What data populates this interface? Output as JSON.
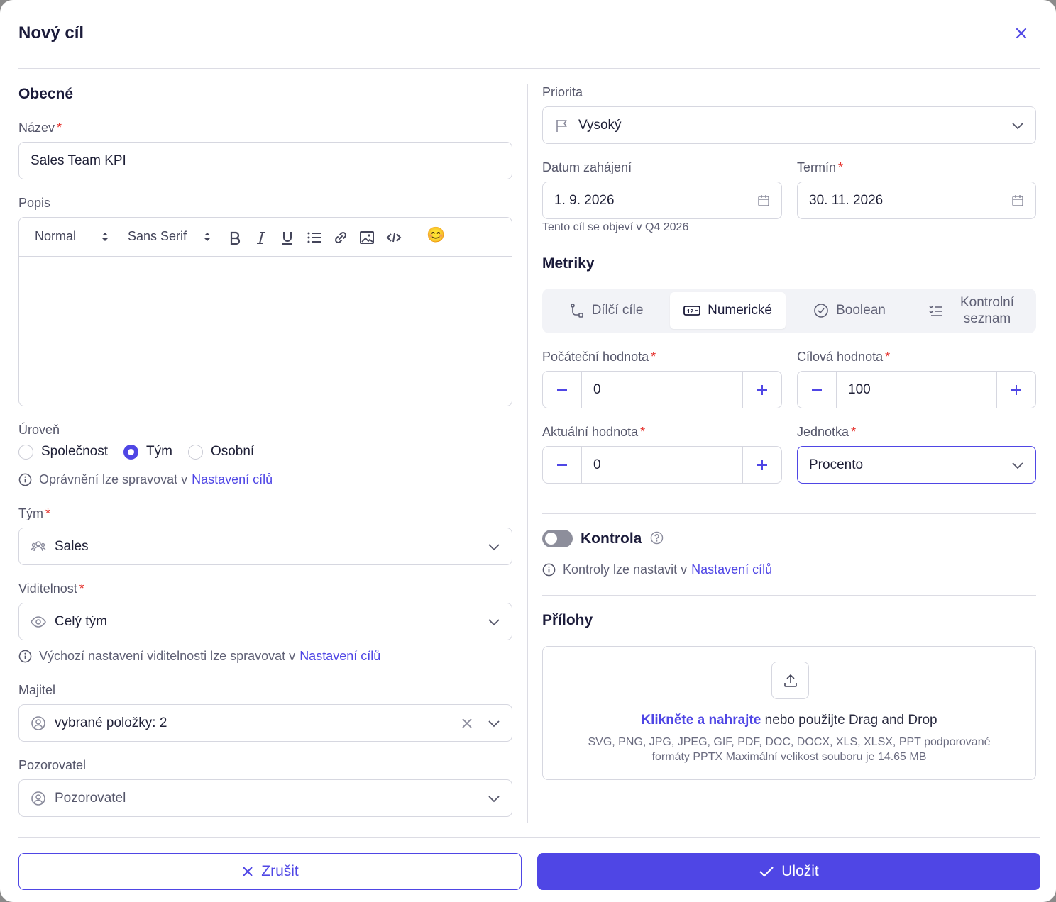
{
  "header": {
    "title": "Nový cíl"
  },
  "general": {
    "section_title": "Obecné",
    "name_label": "Název",
    "name_value": "Sales Team KPI",
    "description_label": "Popis",
    "editor": {
      "format": "Normal",
      "font": "Sans Serif",
      "emoji": "😊"
    },
    "level_label": "Úroveň",
    "level_options": [
      "Společnost",
      "Tým",
      "Osobní"
    ],
    "level_selected": "Tým",
    "permissions_text": "Oprávnění lze spravovat v",
    "settings_link": "Nastavení cílů",
    "team_label": "Tým",
    "team_value": "Sales",
    "visibility_label": "Viditelnost",
    "visibility_value": "Celý tým",
    "visibility_helper": "Výchozí nastavení viditelnosti lze spravovat v",
    "owner_label": "Majitel",
    "owner_value": "vybrané položky: 2",
    "observer_label": "Pozorovatel",
    "observer_placeholder": "Pozorovatel"
  },
  "right": {
    "priority_label": "Priorita",
    "priority_value": "Vysoký",
    "start_label": "Datum zahájení",
    "start_value": "1. 9. 2026",
    "due_label": "Termín",
    "due_value": "30. 11. 2026",
    "date_helper": "Tento cíl se objeví v Q4 2026",
    "metrics_title": "Metriky",
    "tabs": [
      "Dílčí cíle",
      "Numerické",
      "Boolean",
      "Kontrolní seznam"
    ],
    "active_tab": "Numerické",
    "initial_label": "Počáteční hodnota",
    "initial_value": "0",
    "target_label": "Cílová hodnota",
    "target_value": "100",
    "current_label": "Aktuální hodnota",
    "current_value": "0",
    "unit_label": "Jednotka",
    "unit_value": "Procento",
    "control_label": "Kontrola",
    "control_enabled": false,
    "control_helper": "Kontroly lze nastavit v",
    "settings_link": "Nastavení cílů",
    "attachments_title": "Přílohy",
    "upload_link": "Klikněte a nahrajte",
    "upload_text": "nebo použijte Drag and Drop",
    "upload_formats": "SVG, PNG, JPG, JPEG, GIF, PDF, DOC, DOCX, XLS, XLSX, PPT podporované formáty PPTX Maximální velikost souboru je 14.65 MB"
  },
  "footer": {
    "cancel_label": "Zrušit",
    "save_label": "Uložit"
  },
  "colors": {
    "accent": "#4f46e5",
    "required": "#e5322d",
    "border": "#d6d7e0"
  }
}
